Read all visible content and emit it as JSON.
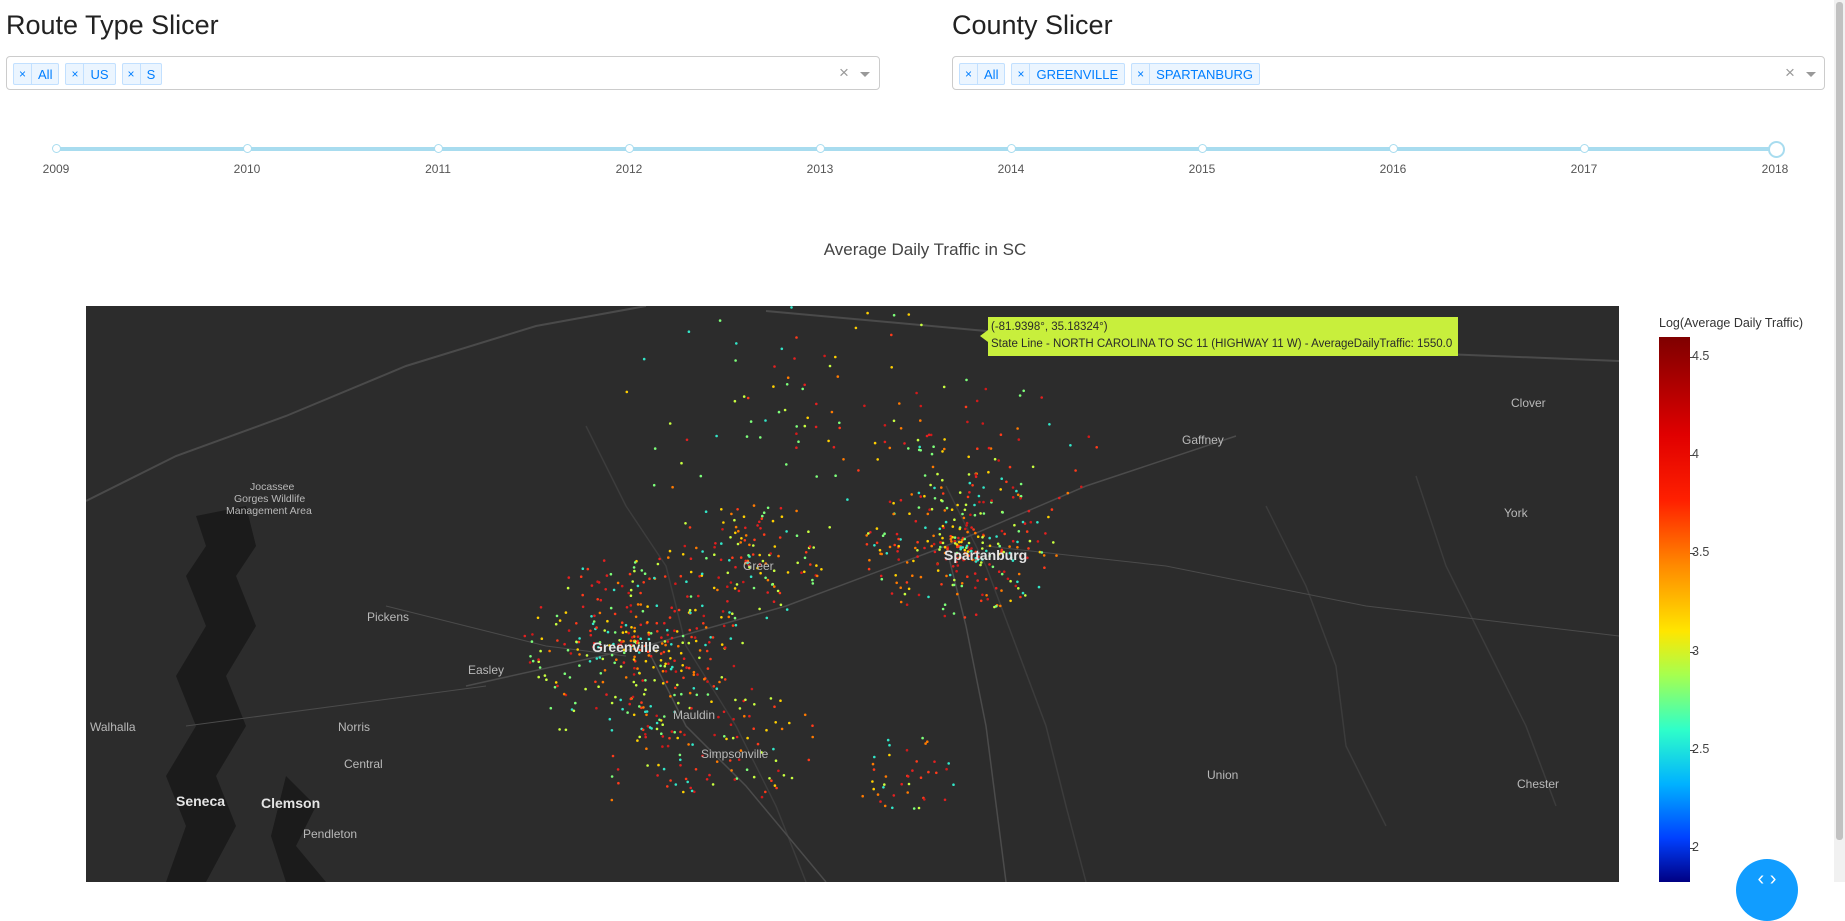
{
  "route_slicer": {
    "title": "Route Type Slicer",
    "selected": [
      "All",
      "US",
      "S"
    ],
    "remove_glyph": "×",
    "clear_glyph": "×"
  },
  "county_slicer": {
    "title": "County Slicer",
    "selected": [
      "All",
      "GREENVILLE",
      "SPARTANBURG"
    ],
    "remove_glyph": "×",
    "clear_glyph": "×"
  },
  "year_slider": {
    "marks": [
      "2009",
      "2010",
      "2011",
      "2012",
      "2013",
      "2014",
      "2015",
      "2016",
      "2017",
      "2018"
    ],
    "selected": "2018"
  },
  "chart": {
    "title": "Average Daily Traffic in SC",
    "tooltip": {
      "coords": "(-81.9398°, 35.18324°)",
      "text": "State Line - NORTH CAROLINA TO SC 11 (HIGHWAY 11 W) - AverageDailyTraffic: 1550.0"
    },
    "map_labels": {
      "jocassee_1": "Jocassee",
      "jocassee_2": "Gorges Wildlife",
      "jocassee_3": "Management Area",
      "pickens": "Pickens",
      "easley": "Easley",
      "greenville": "Greenville",
      "greer": "Greer",
      "spartanburg": "Spartanburg",
      "gaffney": "Gaffney",
      "clover": "Clover",
      "york": "York",
      "walhalla": "Walhalla",
      "norris": "Norris",
      "central": "Central",
      "seneca": "Seneca",
      "clemson": "Clemson",
      "pendleton": "Pendleton",
      "mauldin": "Mauldin",
      "simpsonville": "Simpsonville",
      "union": "Union",
      "chester": "Chester"
    },
    "colorbar": {
      "title": "Log(Average Daily Traffic)",
      "ticks": [
        "4.5",
        "4",
        "3.5",
        "3",
        "2.5",
        "2"
      ]
    },
    "colors": {
      "map_bg": "#2c2c2c",
      "tooltip_bg": "#c8ef3c",
      "chip_bg": "#ebf5ff",
      "chip_text": "#007eff",
      "slider": "#a8dcef",
      "fab": "#119dff"
    }
  },
  "fab_icon": "expand-arrows-icon"
}
